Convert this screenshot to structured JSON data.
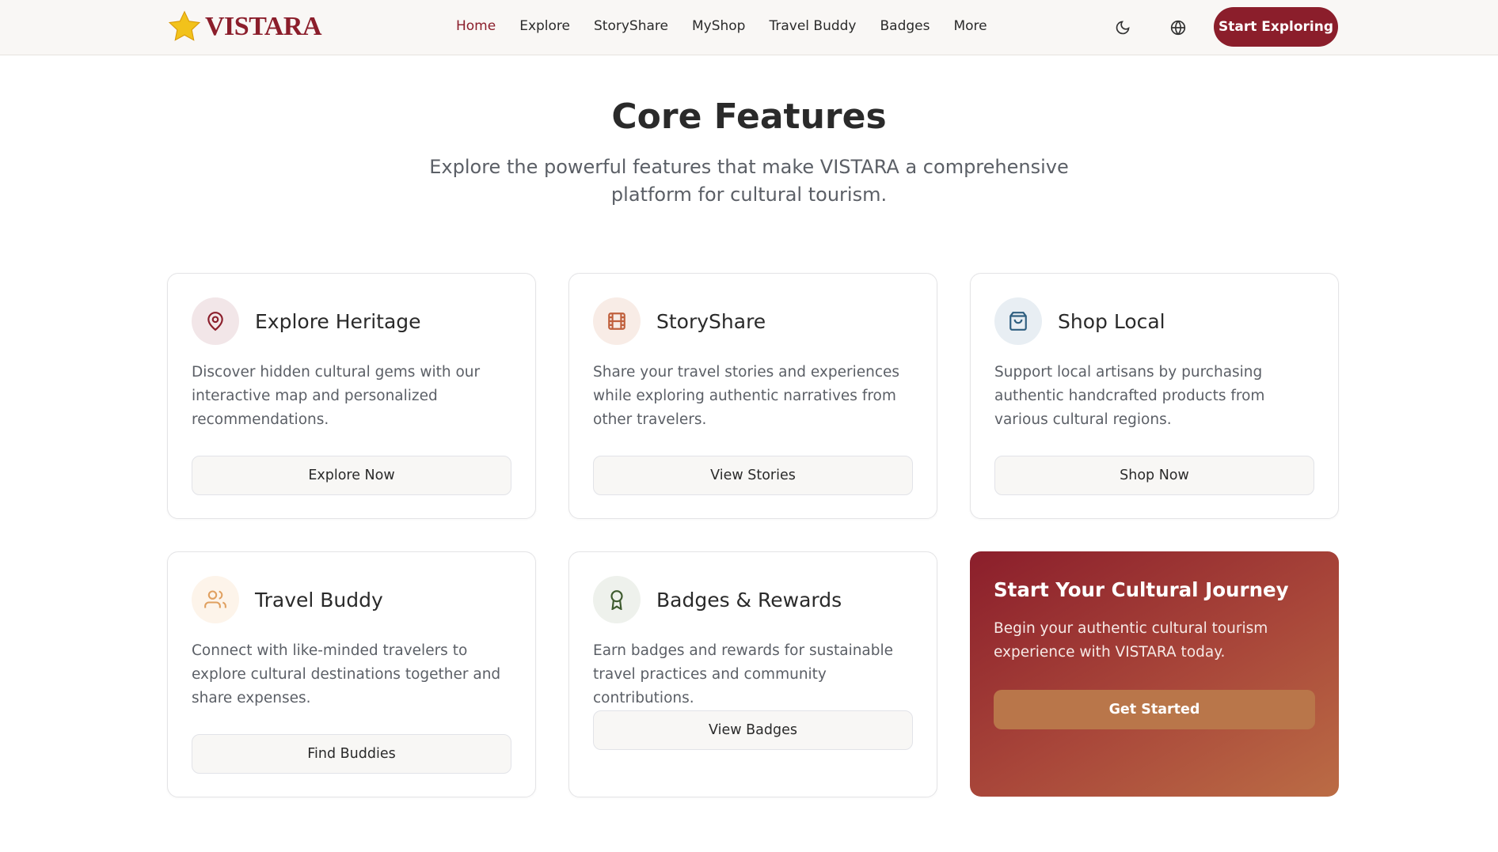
{
  "nav": {
    "logo": "VISTARA",
    "items": [
      {
        "label": "Home",
        "active": true
      },
      {
        "label": "Explore"
      },
      {
        "label": "StoryShare"
      },
      {
        "label": "MyShop"
      },
      {
        "label": "Travel Buddy"
      },
      {
        "label": "Badges"
      },
      {
        "label": "More"
      }
    ],
    "cta": "Start Exploring",
    "icons": [
      "moon-icon",
      "globe-icon"
    ]
  },
  "hero": {
    "title": "Core Features",
    "subtitle": "Explore the powerful features that make VISTARA a comprehensive platform for cultural tourism."
  },
  "cards": [
    {
      "title": "Explore Heritage",
      "desc": "Discover hidden cultural gems with our interactive map and personalized recommendations.",
      "button": "Explore Now",
      "icon": "map-pin-icon",
      "color": "#8b1e2b"
    },
    {
      "title": "StoryShare",
      "desc": "Share your travel stories and experiences while exploring authentic narratives from other travelers.",
      "button": "View Stories",
      "icon": "film-icon",
      "color": "#c0603d"
    },
    {
      "title": "Shop Local",
      "desc": "Support local artisans by purchasing authentic handcrafted products from various cultural regions.",
      "button": "Shop Now",
      "icon": "shopping-bag-icon",
      "color": "#2f5f80"
    },
    {
      "title": "Travel Buddy",
      "desc": "Connect with like-minded travelers to explore cultural destinations together and share expenses.",
      "button": "Find Buddies",
      "icon": "users-icon",
      "color": "#e0a060"
    },
    {
      "title": "Badges & Rewards",
      "desc": "Earn badges and rewards for sustainable travel practices and community contributions.",
      "button": "View Badges",
      "icon": "award-icon",
      "color": "#3d5a2e"
    }
  ],
  "promo": {
    "title": "Start Your Cultural Journey",
    "desc": "Begin your authentic cultural tourism experience with VISTARA today.",
    "button": "Get Started"
  }
}
